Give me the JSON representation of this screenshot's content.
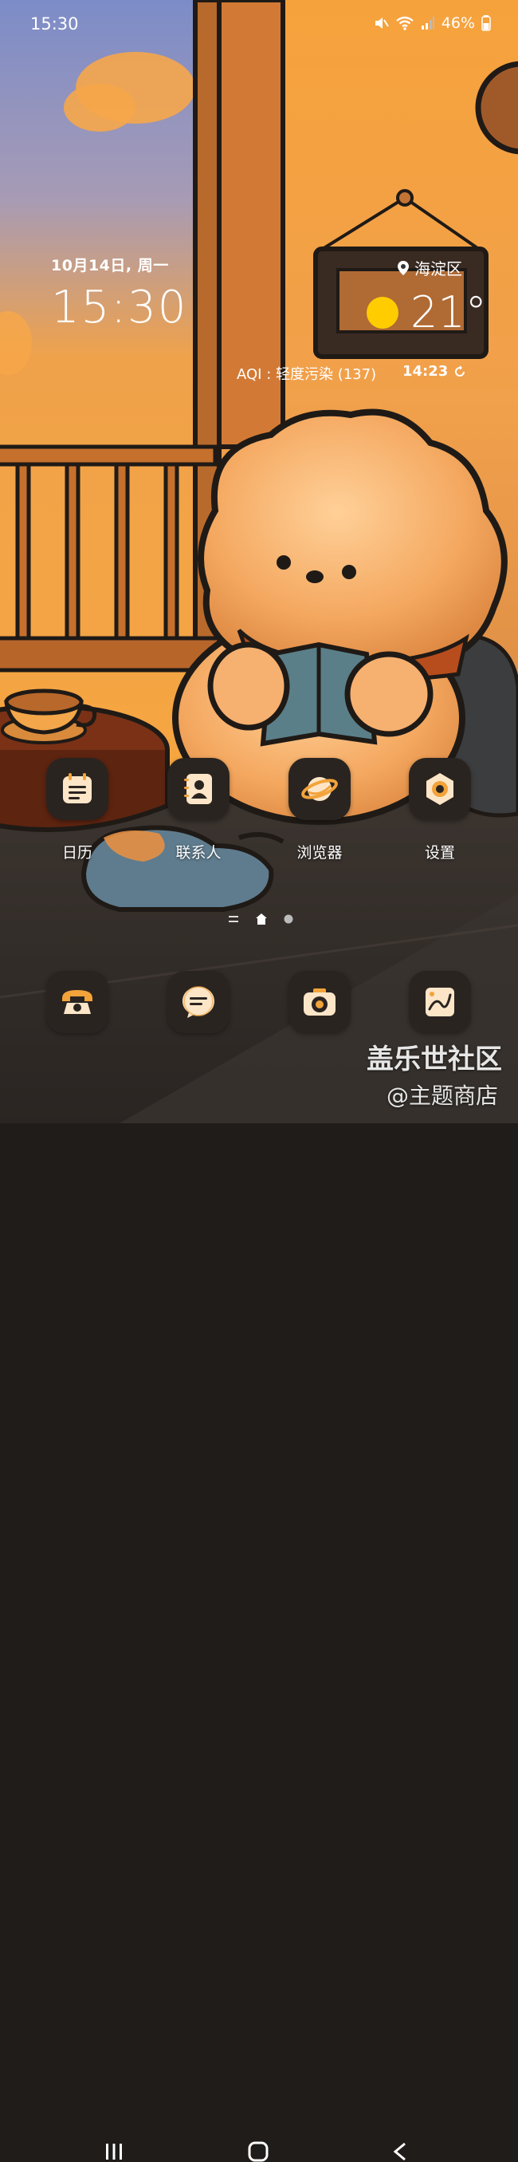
{
  "status_bar": {
    "time": "15:30",
    "battery": "46%",
    "icons": [
      "mute-icon",
      "wifi-icon",
      "signal-icon",
      "battery-icon"
    ]
  },
  "clock_widget": {
    "date": "10月14日, 周一",
    "time": "15:30"
  },
  "weather_widget": {
    "location": "海淀区",
    "temperature": "21°",
    "aqi": "AQI : 轻度污染 (137)",
    "updated": "14:23",
    "icons": [
      "location-pin-icon",
      "sun-icon",
      "refresh-icon"
    ]
  },
  "apps": [
    {
      "label": "日历",
      "icon": "calendar-icon"
    },
    {
      "label": "联系人",
      "icon": "contacts-icon"
    },
    {
      "label": "浏览器",
      "icon": "browser-planet-icon"
    },
    {
      "label": "设置",
      "icon": "settings-gear-icon"
    }
  ],
  "page_indicator": {
    "pages": 2,
    "current": 1
  },
  "dock": [
    {
      "icon": "phone-icon"
    },
    {
      "icon": "messages-icon"
    },
    {
      "icon": "camera-icon"
    },
    {
      "icon": "gallery-icon"
    }
  ],
  "watermark": {
    "line1": "盖乐世社区",
    "line2": "@主题商店"
  },
  "colors": {
    "icon_bg": "#2a2420",
    "icon_accent": "#f2a33a",
    "sun": "#ffcc00"
  }
}
